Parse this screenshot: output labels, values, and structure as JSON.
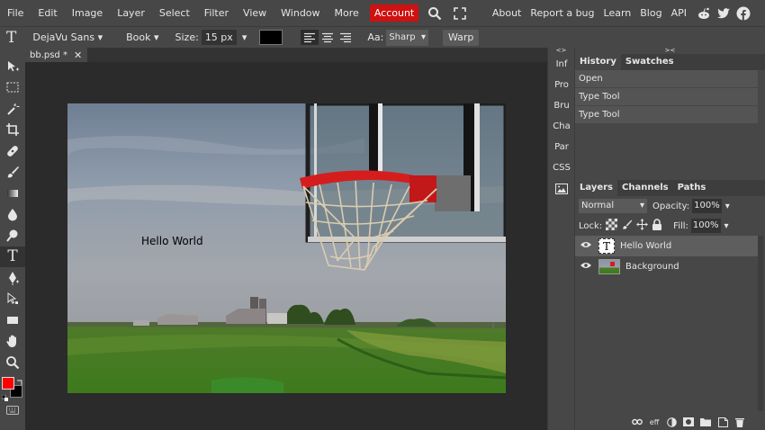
{
  "menu": {
    "items": [
      "File",
      "Edit",
      "Image",
      "Layer",
      "Select",
      "Filter",
      "View",
      "Window",
      "More"
    ],
    "account": "Account",
    "right_links": [
      "About",
      "Report a bug",
      "Learn",
      "Blog",
      "API"
    ]
  },
  "options": {
    "tool_letter": "T",
    "font": "DejaVu Sans",
    "style": "Book",
    "size_label": "Size:",
    "size_value": "15 px",
    "aa_label": "Aa:",
    "aa_value": "Sharp",
    "warp": "Warp"
  },
  "document": {
    "tab_title": "bb.psd *",
    "text_layer_content": "Hello World"
  },
  "mini_panel": [
    "Inf",
    "Pro",
    "Bru",
    "Cha",
    "Par",
    "CSS"
  ],
  "history_panel": {
    "tabs": [
      "History",
      "Swatches"
    ],
    "items": [
      "Open",
      "Type Tool",
      "Type Tool"
    ]
  },
  "layers_panel": {
    "tabs": [
      "Layers",
      "Channels",
      "Paths"
    ],
    "blend_mode": "Normal",
    "opacity_label": "Opacity:",
    "opacity_value": "100%",
    "lock_label": "Lock:",
    "fill_label": "Fill:",
    "fill_value": "100%",
    "layers": [
      {
        "name": "Hello World",
        "type": "text"
      },
      {
        "name": "Background",
        "type": "image"
      }
    ],
    "bottom_icons": [
      "link-icon",
      "effects-icon",
      "adjustment-icon",
      "mask-icon",
      "folder-icon",
      "new-layer-icon",
      "delete-icon"
    ],
    "effects_label": "eff"
  },
  "colors": {
    "foreground": "#ff0000",
    "background": "#000000",
    "account": "#cf1111"
  }
}
